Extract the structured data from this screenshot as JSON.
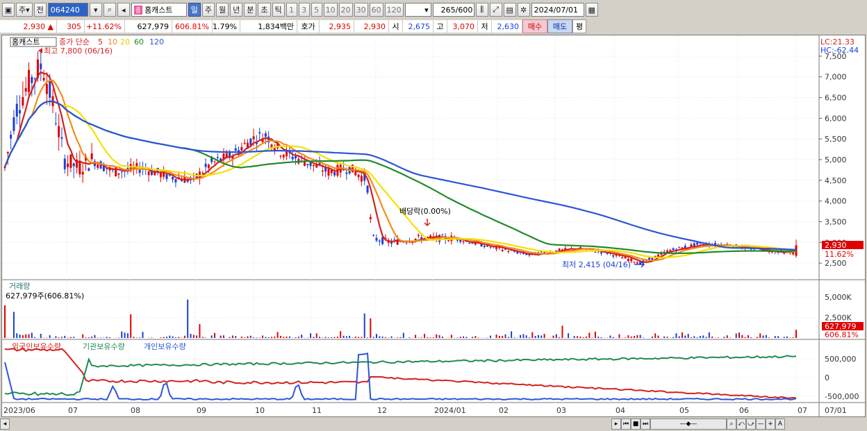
{
  "toolbar": {
    "market_label": "주",
    "market2_label": "전",
    "code": "064240",
    "stock_tag": "종",
    "stock_name": "홈캐스트",
    "periods": [
      "일",
      "주",
      "월",
      "년",
      "분",
      "초",
      "틱"
    ],
    "selected_period": "일",
    "numbers": [
      "1",
      "3",
      "5",
      "10",
      "20",
      "30",
      "60",
      "120"
    ],
    "count_value": "265",
    "count_total": "/600",
    "date": "2024/07/01"
  },
  "quote": {
    "price": "2,930",
    "price_arrow": "▲",
    "change": "305",
    "change_pct": "+11.62%",
    "volume": "627,979",
    "volume_pct": "606.81%",
    "turnover": "1.79%",
    "amount": "1,834백만",
    "ask_label": "호가",
    "ask": "2,935",
    "bid": "2,930",
    "open_label": "시",
    "open": "2,675",
    "high_label": "고",
    "high": "3,070",
    "low_label": "저",
    "low": "2,630",
    "buy_label": "매수",
    "sell_label": "매도",
    "eval_label": "평"
  },
  "price_panel": {
    "legend_name": "홈캐스트",
    "legend_ma_label": "종가 단순",
    "ma_periods": [
      "5",
      "10",
      "20",
      "60",
      "120"
    ],
    "ma_colors": [
      "#d42020",
      "#f08c1c",
      "#f4e000",
      "#1f8b2a",
      "#2b55d8"
    ],
    "max_annotation": "최고 7,800 (06/16)",
    "min_annotation": "최저 2,415 (04/16)",
    "dividend_annotation": "배당락(0.00%)",
    "lc_label": "LC:21.33",
    "hc_label": "HC:-62.44",
    "last_price_tag": "2,930",
    "last_pct_tag": "11.62%",
    "y_ticks": [
      "7,500",
      "7,000",
      "6,500",
      "6,000",
      "5,500",
      "5,000",
      "4,500",
      "4,000",
      "3,500",
      "3,000",
      "2,500"
    ]
  },
  "volume_panel": {
    "title": "거래량",
    "value_label": "627,979주(606.81%)",
    "y_ticks": [
      "5,000K",
      "2,500K"
    ],
    "last_tag": "627,979",
    "last_pct_tag": "606.81%"
  },
  "holder_panel": {
    "legends": [
      "외국인보유수량",
      "기관보유수량",
      "개인보유수량"
    ],
    "legend_colors": [
      "#d42020",
      "#1f8b50",
      "#2b55d8"
    ],
    "y_ticks": [
      "500,000",
      "0",
      "-500,000"
    ]
  },
  "x_axis": {
    "labels": [
      "2023/06",
      "07",
      "08",
      "09",
      "10",
      "11",
      "12",
      "2024/01",
      "02",
      "03",
      "04",
      "05",
      "06",
      "07"
    ],
    "right_label": "07/01"
  },
  "chart_data": {
    "type": "candlestick",
    "title": "홈캐스트",
    "price_range": [
      2300,
      7800
    ],
    "max": {
      "value": 7800,
      "date": "06/16"
    },
    "min": {
      "value": 2415,
      "date": "04/16"
    },
    "last": {
      "close": 2930,
      "open": 2675,
      "high": 3070,
      "low": 2630,
      "volume": 627979
    },
    "grid": true
  },
  "colors": {
    "up": "#e00000",
    "down": "#1a3fd6",
    "accent": "#2e63c5"
  }
}
